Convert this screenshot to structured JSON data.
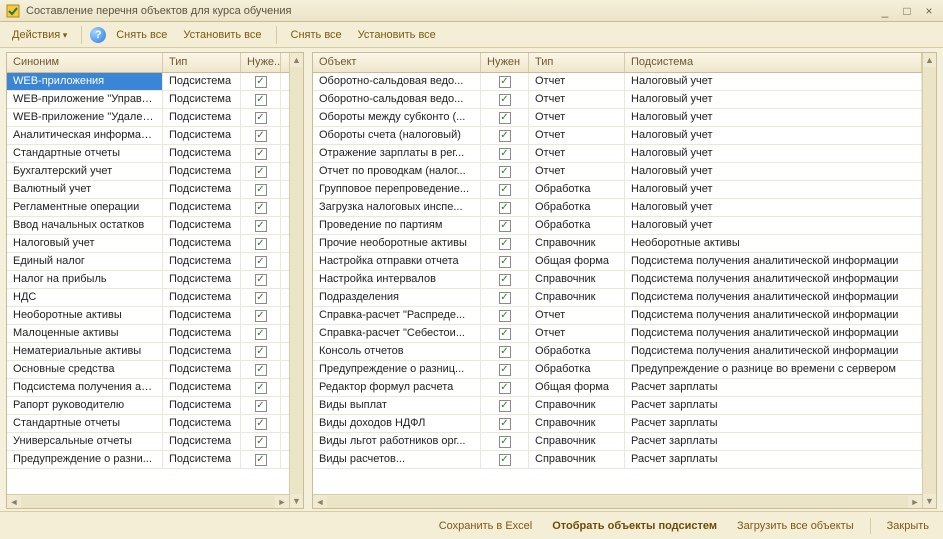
{
  "window": {
    "title": "Составление перечня объектов для курса обучения"
  },
  "toolbar": {
    "actions": "Действия",
    "clear_all_1": "Снять все",
    "set_all_1": "Установить все",
    "clear_all_2": "Снять все",
    "set_all_2": "Установить все"
  },
  "left": {
    "headers": {
      "c1": "Синоним",
      "c2": "Тип",
      "c3": "Нуже..."
    },
    "rows": [
      {
        "syn": "WEB-приложения",
        "type": "Подсистема",
        "chk": true,
        "selected": true
      },
      {
        "syn": "WEB-приложение \"Управл...",
        "type": "Подсистема",
        "chk": true
      },
      {
        "syn": "WEB-приложение \"Удален...",
        "type": "Подсистема",
        "chk": true
      },
      {
        "syn": "Аналитическая информация",
        "type": "Подсистема",
        "chk": true
      },
      {
        "syn": "Стандартные отчеты",
        "type": "Подсистема",
        "chk": true
      },
      {
        "syn": "Бухгалтерский учет",
        "type": "Подсистема",
        "chk": true
      },
      {
        "syn": "Валютный учет",
        "type": "Подсистема",
        "chk": true
      },
      {
        "syn": "Регламентные операции",
        "type": "Подсистема",
        "chk": true
      },
      {
        "syn": "Ввод начальных остатков",
        "type": "Подсистема",
        "chk": true
      },
      {
        "syn": "Налоговый учет",
        "type": "Подсистема",
        "chk": true
      },
      {
        "syn": "Единый налог",
        "type": "Подсистема",
        "chk": true
      },
      {
        "syn": "Налог на прибыль",
        "type": "Подсистема",
        "chk": true
      },
      {
        "syn": "НДС",
        "type": "Подсистема",
        "chk": true
      },
      {
        "syn": "Необоротные активы",
        "type": "Подсистема",
        "chk": true
      },
      {
        "syn": "Малоценные активы",
        "type": "Подсистема",
        "chk": true
      },
      {
        "syn": "Нематериальные активы",
        "type": "Подсистема",
        "chk": true
      },
      {
        "syn": "Основные средства",
        "type": "Подсистема",
        "chk": true
      },
      {
        "syn": "Подсистема получения ана...",
        "type": "Подсистема",
        "chk": true
      },
      {
        "syn": "Рапорт руководителю",
        "type": "Подсистема",
        "chk": true
      },
      {
        "syn": "Стандартные отчеты",
        "type": "Подсистема",
        "chk": true
      },
      {
        "syn": "Универсальные отчеты",
        "type": "Подсистема",
        "chk": true
      },
      {
        "syn": "Предупреждение о разни...",
        "type": "Подсистема",
        "chk": true
      }
    ]
  },
  "right": {
    "headers": {
      "c1": "Объект",
      "c2": "Нужен",
      "c3": "Тип",
      "c4": "Подсистема"
    },
    "rows": [
      {
        "obj": "Оборотно-сальдовая ведо...",
        "chk": true,
        "type": "Отчет",
        "sub": "Налоговый учет"
      },
      {
        "obj": "Оборотно-сальдовая ведо...",
        "chk": true,
        "type": "Отчет",
        "sub": "Налоговый учет"
      },
      {
        "obj": "Обороты между субконто (...",
        "chk": true,
        "type": "Отчет",
        "sub": "Налоговый учет"
      },
      {
        "obj": "Обороты счета (налоговый)",
        "chk": true,
        "type": "Отчет",
        "sub": "Налоговый учет"
      },
      {
        "obj": "Отражение зарплаты в рег...",
        "chk": true,
        "type": "Отчет",
        "sub": "Налоговый учет"
      },
      {
        "obj": "Отчет по проводкам (налог...",
        "chk": true,
        "type": "Отчет",
        "sub": "Налоговый учет"
      },
      {
        "obj": "Групповое перепроведение...",
        "chk": true,
        "type": "Обработка",
        "sub": "Налоговый учет"
      },
      {
        "obj": "Загрузка налоговых инспе...",
        "chk": true,
        "type": "Обработка",
        "sub": "Налоговый учет"
      },
      {
        "obj": "Проведение по партиям",
        "chk": true,
        "type": "Обработка",
        "sub": "Налоговый учет"
      },
      {
        "obj": "Прочие необоротные активы",
        "chk": true,
        "type": "Справочник",
        "sub": "Необоротные активы"
      },
      {
        "obj": "Настройка отправки отчета",
        "chk": true,
        "type": "Общая форма",
        "sub": "Подсистема получения аналитической информации"
      },
      {
        "obj": "Настройка интервалов",
        "chk": true,
        "type": "Справочник",
        "sub": "Подсистема получения аналитической информации"
      },
      {
        "obj": "Подразделения",
        "chk": true,
        "type": "Справочник",
        "sub": "Подсистема получения аналитической информации"
      },
      {
        "obj": "Справка-расчет \"Распреде...",
        "chk": true,
        "type": "Отчет",
        "sub": "Подсистема получения аналитической информации"
      },
      {
        "obj": "Справка-расчет \"Себестои...",
        "chk": true,
        "type": "Отчет",
        "sub": "Подсистема получения аналитической информации"
      },
      {
        "obj": "Консоль отчетов",
        "chk": true,
        "type": "Обработка",
        "sub": "Подсистема получения аналитической информации"
      },
      {
        "obj": "Предупреждение о разниц...",
        "chk": true,
        "type": "Обработка",
        "sub": "Предупреждение о разнице во времени с сервером"
      },
      {
        "obj": "Редактор формул расчета",
        "chk": true,
        "type": "Общая форма",
        "sub": "Расчет зарплаты"
      },
      {
        "obj": "Виды выплат",
        "chk": true,
        "type": "Справочник",
        "sub": "Расчет зарплаты"
      },
      {
        "obj": "Виды доходов НДФЛ",
        "chk": true,
        "type": "Справочник",
        "sub": "Расчет зарплаты"
      },
      {
        "obj": "Виды льгот работников орг...",
        "chk": true,
        "type": "Справочник",
        "sub": "Расчет зарплаты"
      },
      {
        "obj": "Виды расчетов...",
        "chk": true,
        "type": "Справочник",
        "sub": "Расчет зарплаты"
      }
    ]
  },
  "footer": {
    "save_excel": "Сохранить в Excel",
    "select_objects": "Отобрать объекты подсистем",
    "load_all": "Загрузить все объекты",
    "close": "Закрыть"
  }
}
